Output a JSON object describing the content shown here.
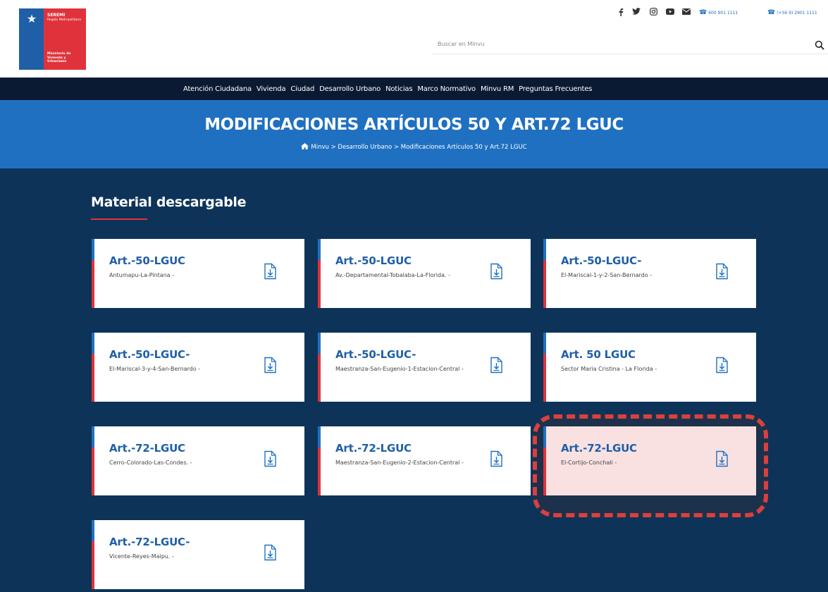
{
  "header": {
    "logo": {
      "org": "SEREMI",
      "region": "Región Metropolitana",
      "ministry": "Ministerio de Vivienda y Urbanismo"
    },
    "social_icons": [
      "facebook-icon",
      "twitter-icon",
      "instagram-icon",
      "youtube-icon",
      "mail-icon"
    ],
    "phones": [
      "600 901 1111",
      "(+56 9) 2901 1111"
    ],
    "search": {
      "placeholder": "Buscar en Minvu"
    }
  },
  "nav": {
    "items": [
      "Atención Ciudadana",
      "Vivienda",
      "Ciudad",
      "Desarrollo Urbano",
      "Noticias",
      "Marco Normativo",
      "Minvu RM",
      "Preguntas Frecuentes"
    ]
  },
  "banner": {
    "title": "MODIFICACIONES ARTÍCULOS 50 Y ART.72 LGUC",
    "breadcrumb": "Minvu > Desarrollo Urbano > Modificaciones Artículos 50 y Art.72 LGUC"
  },
  "main": {
    "section_title": "Material descargable",
    "cards": [
      {
        "title": "Art.-50-LGUC",
        "subtitle": "Antumapu-La-Pintana -"
      },
      {
        "title": "Art.-50-LGUC",
        "subtitle": "Av.-Departamental-Tobalaba-La-Florida. -"
      },
      {
        "title": "Art.-50-LGUC-",
        "subtitle": "El-Mariscal-1-y-2-San-Bernardo -"
      },
      {
        "title": "Art.-50-LGUC-",
        "subtitle": "El-Mariscal-3-y-4-San-Bernardo -"
      },
      {
        "title": "Art.-50-LGUC-",
        "subtitle": "Maestranza-San-Eugenio-1-Estacion-Central -"
      },
      {
        "title": "Art. 50 LGUC",
        "subtitle": "Sector Maria Cristina - La Florida -"
      },
      {
        "title": "Art.-72-LGUC",
        "subtitle": "Cerro-Colorado-Las-Condes. -"
      },
      {
        "title": "Art.-72-LGUC",
        "subtitle": "Maestranza-San-Eugenio-2-Estacion-Central -"
      },
      {
        "title": "Art.-72-LGUC",
        "subtitle": "El-Cortijo-Conchali -"
      },
      {
        "title": "Art.-72-LGUC-",
        "subtitle": "Vicente-Reyes-Maipu. -"
      }
    ]
  },
  "colors": {
    "nav_bg": "#0b1a33",
    "banner_bg": "#1f70c1",
    "main_bg": "#0e3358",
    "accent_red": "#e0323a",
    "title_blue": "#1f5fa8",
    "highlight_fill": "#f9e1e1"
  }
}
